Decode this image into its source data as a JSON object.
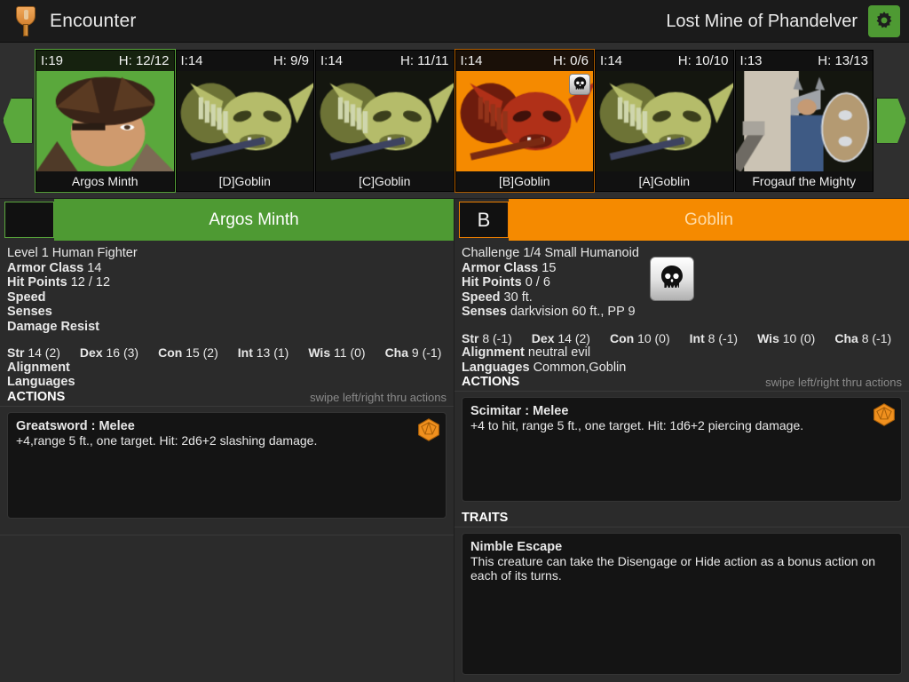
{
  "header": {
    "icon": "torch-icon",
    "title": "Encounter",
    "campaign": "Lost Mine of Phandelver",
    "settings_icon": "gear-icon"
  },
  "initiative": {
    "prev_label": "previous-combatant",
    "next_label": "next-combatant",
    "combatants": [
      {
        "initiative": "I:19",
        "hp": "H: 12/12",
        "name": "Argos Minth",
        "state": "active",
        "portrait": "human-fighter"
      },
      {
        "initiative": "I:14",
        "hp": "H: 9/9",
        "name": "[D]Goblin",
        "state": "normal",
        "portrait": "goblin"
      },
      {
        "initiative": "I:14",
        "hp": "H: 11/11",
        "name": "[C]Goblin",
        "state": "normal",
        "portrait": "goblin"
      },
      {
        "initiative": "I:14",
        "hp": "H: 0/6",
        "name": "[B]Goblin",
        "state": "dead",
        "portrait": "goblin",
        "badge": "skull-icon"
      },
      {
        "initiative": "I:14",
        "hp": "H: 10/10",
        "name": "[A]Goblin",
        "state": "normal",
        "portrait": "goblin"
      },
      {
        "initiative": "I:13",
        "hp": "H: 13/13",
        "name": "Frogauf the Mighty",
        "state": "normal",
        "portrait": "dwarf-warrior"
      }
    ]
  },
  "left_panel": {
    "tag": "",
    "name": "Argos Minth",
    "subtitle": "Level 1 Human Fighter",
    "stats": [
      {
        "label": "Armor Class",
        "value": "14"
      },
      {
        "label": "Hit Points",
        "value": "12 / 12"
      },
      {
        "label": "Speed",
        "value": ""
      },
      {
        "label": "Senses",
        "value": ""
      },
      {
        "label": "Damage Resist",
        "value": ""
      }
    ],
    "abilities": [
      {
        "label": "Str",
        "value": "14 (2)"
      },
      {
        "label": "Dex",
        "value": "16 (3)"
      },
      {
        "label": "Con",
        "value": "15 (2)"
      },
      {
        "label": "Int",
        "value": "13 (1)"
      },
      {
        "label": "Wis",
        "value": "11 (0)"
      },
      {
        "label": "Cha",
        "value": "9 (-1)"
      }
    ],
    "trailing_stats": [
      {
        "label": "Alignment",
        "value": ""
      },
      {
        "label": "Languages",
        "value": ""
      }
    ],
    "actions_header": "ACTIONS",
    "actions_hint": "swipe left/right thru actions",
    "actions": [
      {
        "title": "Greatsword : Melee",
        "body": "+4,range 5 ft., one target. Hit: 2d6+2 slashing damage.",
        "dice_icon": "d20-icon"
      }
    ]
  },
  "right_panel": {
    "tag": "B",
    "name": "Goblin",
    "subtitle": "Challenge 1/4 Small Humanoid",
    "status_icon": "skull-icon",
    "stats": [
      {
        "label": "Armor Class",
        "value": "15"
      },
      {
        "label": "Hit Points",
        "value": "0 / 6"
      },
      {
        "label": "Speed",
        "value": "30 ft."
      },
      {
        "label": "Senses",
        "value": "darkvision 60 ft., PP 9"
      }
    ],
    "abilities": [
      {
        "label": "Str",
        "value": "8 (-1)"
      },
      {
        "label": "Dex",
        "value": "14 (2)"
      },
      {
        "label": "Con",
        "value": "10 (0)"
      },
      {
        "label": "Int",
        "value": "8 (-1)"
      },
      {
        "label": "Wis",
        "value": "10 (0)"
      },
      {
        "label": "Cha",
        "value": "8 (-1)"
      }
    ],
    "trailing_stats": [
      {
        "label": "Alignment",
        "value": "neutral evil"
      },
      {
        "label": "Languages",
        "value": "Common,Goblin"
      }
    ],
    "actions_header": "ACTIONS",
    "actions_hint": "swipe left/right thru actions",
    "actions": [
      {
        "title": "Scimitar : Melee",
        "body": "+4 to hit, range 5 ft., one target. Hit: 1d6+2 piercing damage.",
        "dice_icon": "d20-icon"
      }
    ],
    "traits_header": "TRAITS",
    "traits": [
      {
        "title": "Nimble Escape",
        "body": "This creature can take the Disengage or Hide action as a bonus action on each of its turns."
      }
    ]
  },
  "colors": {
    "active_green": "#4e9a33",
    "dead_orange": "#f08000",
    "panel_bg": "#2b2b2b",
    "header_bg": "#1b1b1b",
    "dice_orange": "#f0901e"
  }
}
